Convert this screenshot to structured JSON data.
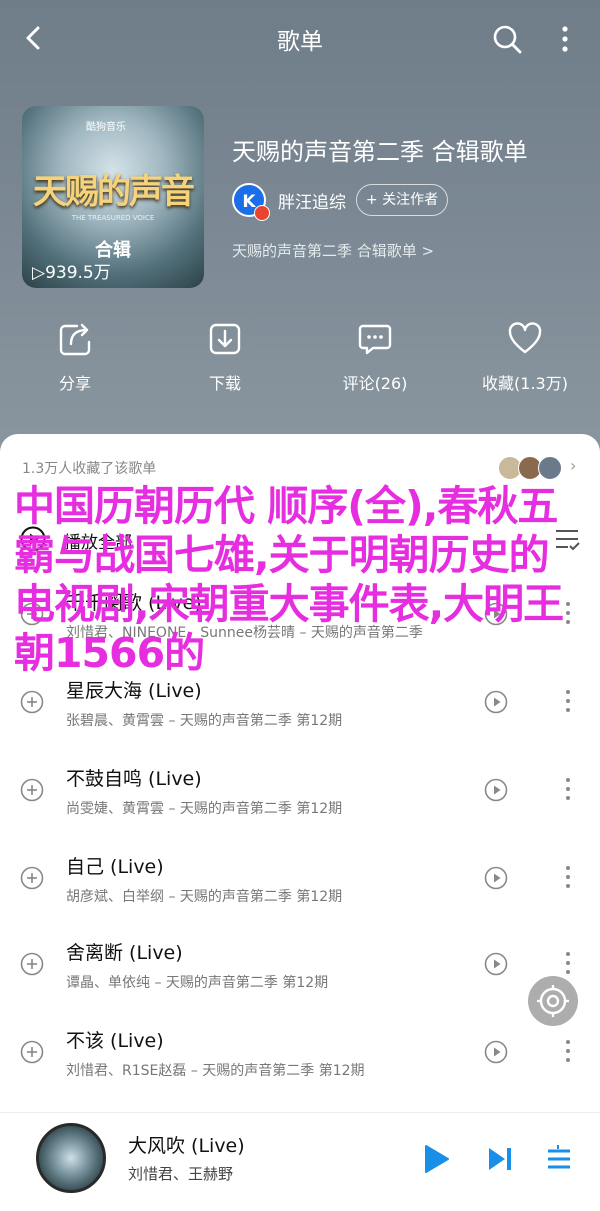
{
  "header": {
    "title": "歌单"
  },
  "playlist": {
    "cover": {
      "brand": "酷狗音乐",
      "show_name": "天赐的声音",
      "sub": "THE TREASURED VOICE",
      "tag": "合辑",
      "plays": "939.5万"
    },
    "title": "天赐的声音第二季 合辑歌单",
    "creator": {
      "avatar_letter": "K",
      "name": "胖汪追综",
      "follow_label": "+ 关注作者"
    },
    "description": "天赐的声音第二季 合辑歌单 >"
  },
  "actions": [
    {
      "label": "分享",
      "icon": "share-icon"
    },
    {
      "label": "下载",
      "icon": "download-icon"
    },
    {
      "label": "评论(26)",
      "icon": "comment-icon"
    },
    {
      "label": "收藏(1.3万)",
      "icon": "heart-icon"
    }
  ],
  "favorites": {
    "text": "1.3万人收藏了该歌单"
  },
  "play_all": {
    "label": "播放全部"
  },
  "songs": [
    {
      "title": "千千阕歌 (Live)",
      "meta": "刘惜君、NINEONE、Sunnee杨芸晴 – 天赐的声音第二季"
    },
    {
      "title": "星辰大海 (Live)",
      "meta": "张碧晨、黄霄雲 – 天赐的声音第二季 第12期"
    },
    {
      "title": "不鼓自鸣 (Live)",
      "meta": "尚雯婕、黄霄雲 – 天赐的声音第二季 第12期"
    },
    {
      "title": "自己 (Live)",
      "meta": "胡彦斌、白举纲 – 天赐的声音第二季 第12期"
    },
    {
      "title": "舍离断 (Live)",
      "meta": "谭晶、单依纯 – 天赐的声音第二季 第12期"
    },
    {
      "title": "不该 (Live)",
      "meta": "刘惜君、R1SE赵磊 – 天赐的声音第二季 第12期"
    }
  ],
  "now_playing": {
    "title": "大风吹 (Live)",
    "artist": "刘惜君、王赫野"
  },
  "overlay_text": "中国历朝历代 顺序(全),春秋五霸与战国七雄,关于明朝历史的电视剧,宋朝重大事件表,大明王朝1566的",
  "colors": {
    "accent": "#1a8fe8",
    "overlay": "#e62ee0",
    "header_bg": "#7b8894"
  }
}
